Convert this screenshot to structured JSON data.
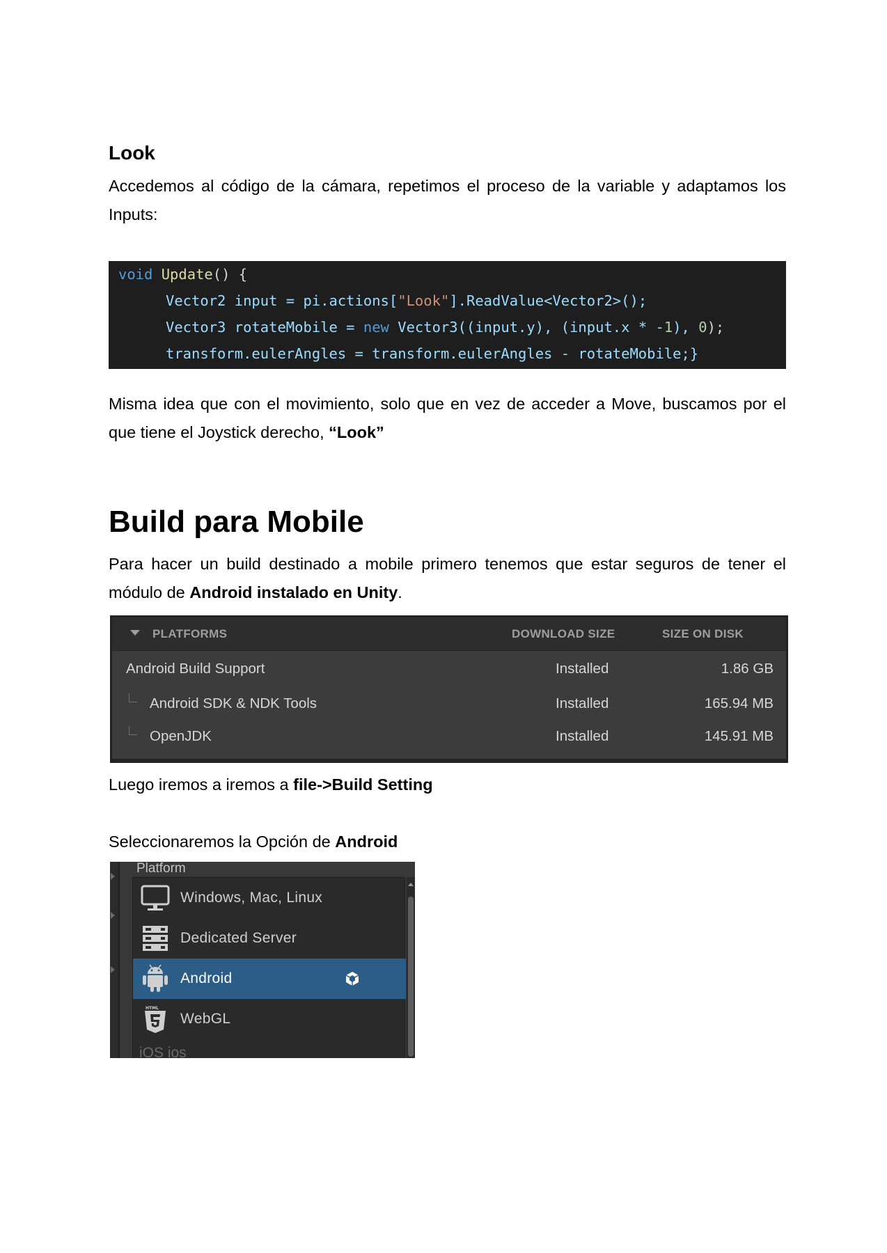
{
  "look": {
    "heading": "Look",
    "intro": "Accedemos al código de la cámara, repetimos el proceso de la variable y adaptamos los Inputs:",
    "code": {
      "line1": {
        "kw": "void",
        "fn": "Update",
        "rest": "() {"
      },
      "line2": {
        "a": "Vector2 input = pi.actions[",
        "str": "\"Look\"",
        "b": "].ReadValue<Vector2>();"
      },
      "line3": {
        "a": "Vector3 rotateMobile = ",
        "kw": "new",
        "b": " Vector3((input.y), (input.x * -",
        "n1": "1",
        "c": "), ",
        "n2": "0",
        "d": ");"
      },
      "line4": "transform.eulerAngles = transform.eulerAngles - rotateMobile;}"
    },
    "after_pre": "Misma idea que con el movimiento, solo que en vez de acceder a Move, buscamos por el que tiene el Joystick derecho, ",
    "after_bold": "“Look”"
  },
  "build": {
    "heading": "Build para Mobile",
    "intro_pre": "Para hacer un build destinado a mobile primero tenemos que estar seguros de tener el módulo de ",
    "intro_bold": "Android instalado en Unity",
    "intro_post": ".",
    "platforms": {
      "header": {
        "platforms": "PLATFORMS",
        "download": "DOWNLOAD SIZE",
        "disk": "SIZE ON DISK"
      },
      "rows": [
        {
          "name": "Android Build Support",
          "status": "Installed",
          "size": "1.86 GB"
        },
        {
          "name": "Android SDK & NDK Tools",
          "status": "Installed",
          "size": "165.94 MB"
        },
        {
          "name": "OpenJDK",
          "status": "Installed",
          "size": "145.91 MB"
        }
      ]
    },
    "then_pre": "Luego iremos a  iremos a ",
    "then_bold": "file->Build Setting",
    "select_pre": "Seleccionaremos la Opción de ",
    "select_bold": "Android",
    "settings": {
      "title": "Platform",
      "items": [
        {
          "label": "Windows, Mac, Linux",
          "icon": "monitor-icon"
        },
        {
          "label": "Dedicated Server",
          "icon": "server-icon"
        },
        {
          "label": "Android",
          "icon": "android-icon",
          "selected": true
        },
        {
          "label": "WebGL",
          "icon": "html5-icon"
        }
      ],
      "cut_label": "iOS  ios"
    }
  }
}
